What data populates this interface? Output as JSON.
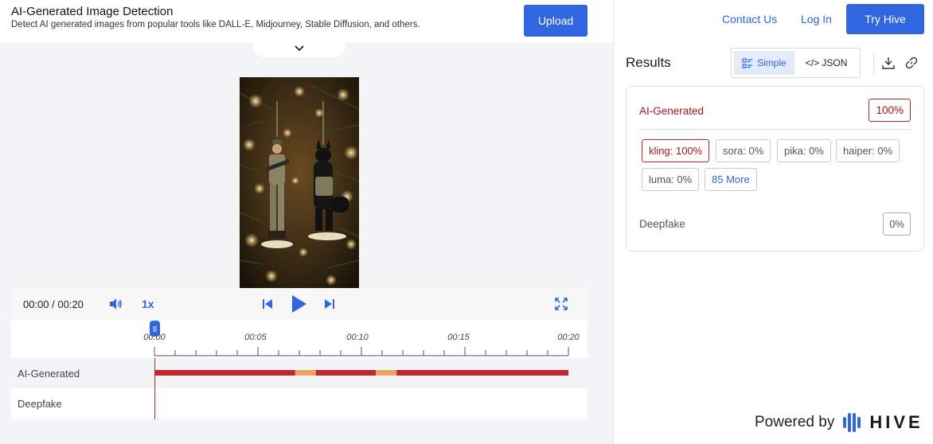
{
  "header": {
    "title": "AI-Generated Image Detection",
    "subtitle": "Detect AI generated images from popular tools like DALL-E, Midjourney, Stable Diffusion, and others.",
    "upload_label": "Upload"
  },
  "nav": {
    "contact": "Contact Us",
    "login": "Log In",
    "try": "Try Hive"
  },
  "player": {
    "timecode": "00:00 / 00:20",
    "speed": "1x",
    "ticks": [
      "00:00",
      "00:05",
      "00:10",
      "00:15",
      "00:20"
    ],
    "duration_seconds": 20,
    "current_seconds": 0
  },
  "timeline": {
    "rows": [
      {
        "label": "AI-Generated",
        "segments": [
          {
            "start": 0,
            "end": 6.8,
            "level": "high"
          },
          {
            "start": 6.8,
            "end": 7.8,
            "level": "medium"
          },
          {
            "start": 7.8,
            "end": 10.7,
            "level": "high"
          },
          {
            "start": 10.7,
            "end": 11.7,
            "level": "medium"
          },
          {
            "start": 11.7,
            "end": 20,
            "level": "high"
          }
        ]
      },
      {
        "label": "Deepfake",
        "segments": []
      }
    ],
    "colors": {
      "high": "#c0272d",
      "medium": "#eaa45c"
    }
  },
  "results": {
    "title": "Results",
    "tabs": [
      {
        "label": "Simple",
        "icon": "list-view-icon",
        "active": true
      },
      {
        "label": "</> JSON",
        "icon": "",
        "active": false
      }
    ],
    "ai_generated": {
      "label": "AI-Generated",
      "score": "100%",
      "sources": [
        "kling: 100%",
        "sora: 0%",
        "pika: 0%",
        "haiper: 0%",
        "luma: 0%"
      ],
      "more": "85 More"
    },
    "deepfake": {
      "label": "Deepfake",
      "score": "0%"
    }
  },
  "footer": {
    "powered_by": "Powered by",
    "brand": "HIVE"
  },
  "colors": {
    "accent": "#2f66e0",
    "danger": "#c0272d"
  }
}
